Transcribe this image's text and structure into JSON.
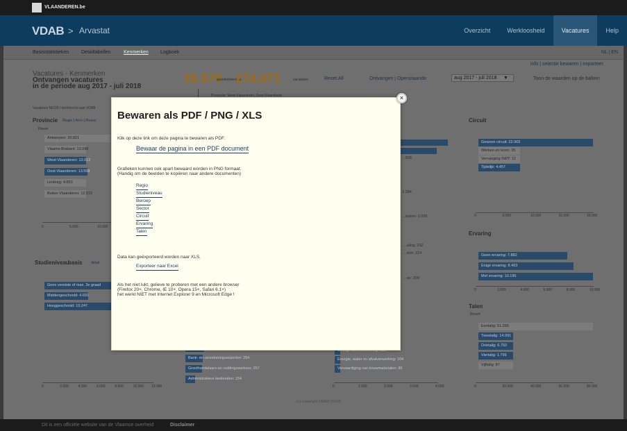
{
  "topbar": {
    "site": "VLAANDEREN.be"
  },
  "header": {
    "logo": "VDAB",
    "breadcrumb_sep": ">",
    "breadcrumb": "Arvastat",
    "nav": [
      "Overzicht",
      "Werkloosheid",
      "Vacatures",
      "Help"
    ],
    "active_nav": "Vacatures"
  },
  "subnav": {
    "items": [
      "Basisstatistieken",
      "Detailtabellen",
      "Kenmerken",
      "Logboek"
    ],
    "active": "Kenmerken",
    "lang": "NL | EN"
  },
  "background": {
    "top_links": "info | selectie bewaren | exporteer",
    "title_line1": "Vacatures - Kenmerken",
    "title_line2": "Ontvangen vacatures",
    "title_line3": "in de periode aug 2017 - juli 2018",
    "count_selected": "26.570",
    "selected_label": "geselecteerd uit",
    "count_total": "274.471",
    "total_label": "vacatures",
    "reset_all": "Reset All",
    "status_toggle": "Ontvangen | Openstaande",
    "period_select": "aug 2017 - juli 2018",
    "show_values": "Toon de waarden op de balken",
    "province_filter": "Provincie: West-Vlaanderen, Oost-Vlaanderen",
    "vacatures_note": "Vacatures NEOS / technische aan VDAB",
    "province_title": "Provincie",
    "province_links": "Regio | Arro | Resoc",
    "province_reset": "Reset",
    "province_bars": [
      {
        "label": "Antwerpen: 20.821",
        "highlight": false,
        "value": 20821
      },
      {
        "label": "Vlaams-Brabant: 13.096",
        "highlight": false,
        "value": 13096
      },
      {
        "label": "West-Vlaanderen: 13.012",
        "highlight": true,
        "value": 13012
      },
      {
        "label": "Oost-Vlaanderen: 13.558",
        "highlight": true,
        "value": 13558
      },
      {
        "label": "Limburg: 4.853",
        "highlight": false,
        "value": 4853
      },
      {
        "label": "Buiten Vlaanderen: 12.572",
        "highlight": false,
        "value": 12572
      }
    ],
    "province_ticks": [
      "0",
      "5.000",
      "10.000"
    ],
    "study_title": "Studieniveau",
    "study_sub": "basis",
    "study_detail": "detail",
    "study_bars": [
      {
        "label": "Geen vereiste of max. 2e graad",
        "value": 10500
      },
      {
        "label": "Middengeschoold: 4.691",
        "value": 4691
      },
      {
        "label": "Hooggeschoold: 10.247",
        "value": 10247
      }
    ],
    "study_ticks": [
      "0",
      "2.000",
      "4.000",
      "6.000",
      "8.000",
      "10.000",
      "12.000"
    ],
    "center_bars": [
      {
        "label": "Ambachtslieden en experten studiedienst: 286",
        "value": 286
      },
      {
        "label": "Bank- en verzekeringsexperten: 264",
        "value": 264
      },
      {
        "label": "Groothandelaars en reddingswerkers: 257",
        "value": 257
      },
      {
        "label": "Administratieve bedienden: 154",
        "value": 154
      }
    ],
    "center_axis_ticks": [
      "0"
    ],
    "sector_labels": [
      {
        "label": "...508"
      },
      {
        "label": "1.284"
      },
      {
        "label": "...staten: 1.035"
      },
      {
        "label": "...aling: 232"
      },
      {
        "label": "...rton: 224"
      },
      {
        "label": "...an: 209"
      }
    ],
    "sector_bars": [
      {
        "label": "Overige dienstverlening: 135",
        "value": 135
      },
      {
        "label": "Energie, water en afvalverwerking: 104",
        "value": 104
      },
      {
        "label": "Vervaardiging van bouwmaterialen: 85",
        "value": 85
      }
    ],
    "sector_ticks": [
      "0",
      "1.000",
      "2.000",
      "3.000",
      "4.000"
    ],
    "circuit_title": "Circuit",
    "circuit_bars": [
      {
        "label": "Gewoon circuit: 22.065",
        "highlight": true,
        "value": 22065
      },
      {
        "label": "Werken en leren: 35",
        "highlight": false,
        "value": 35
      },
      {
        "label": "Vervanging SWT: 12",
        "highlight": false,
        "value": 12
      },
      {
        "label": "Tijdelijk: 4.457",
        "highlight": true,
        "value": 4457
      }
    ],
    "circuit_ticks": [
      "0",
      "5.000",
      "10.000",
      "15.000",
      "20.000"
    ],
    "ervaring_title": "Ervaring",
    "ervaring_bars": [
      {
        "label": "Geen ervaring: 7.882",
        "value": 7882
      },
      {
        "label": "Enige ervaring: 8.493",
        "value": 8493
      },
      {
        "label": "Met ervaring: 10.195",
        "value": 10195
      }
    ],
    "ervaring_ticks": [
      "0",
      "2.000",
      "4.000",
      "6.000",
      "8.000",
      "10.000"
    ],
    "talen_title": "Talen",
    "talen_reset": "Reset",
    "talen_bars": [
      {
        "label": "Eentalig: 51.265",
        "highlight": false,
        "value": 51265
      },
      {
        "label": "Tweetalig: 14.091",
        "highlight": true,
        "value": 14091
      },
      {
        "label": "Drietalig: 6.793",
        "highlight": true,
        "value": 6793
      },
      {
        "label": "Viertalig: 1.799",
        "highlight": true,
        "value": 1799
      },
      {
        "label": "Vijftalig: 87",
        "highlight": false,
        "value": 87
      }
    ],
    "talen_ticks": [
      "0",
      "20.000",
      "40.000",
      "60.000",
      "80.000"
    ],
    "copyright": "(c) copyright VDAB (2018)"
  },
  "modal": {
    "title": "Bewaren als PDF / PNG / XLS",
    "pdf_intro": "Klik op deze link om deze pagina te bewaren als PDF.",
    "pdf_link": "Bewaar de pagina in een PDF document",
    "png_intro1": "Grafieken kunnen ook apart bewaard worden in PNG formaat.",
    "png_intro2": "(Handig om de beelden te kopiëren naar andere documenten)",
    "png_links": [
      "Regio",
      "Studieniveau",
      "Beroep",
      "Sector",
      "Circuit",
      "Ervaring",
      "Talen"
    ],
    "xls_intro": "Data kan geëxporteerd worden naar XLS.",
    "xls_link": "Exporteer naar Excel",
    "browser_note1": "Als het niet lukt, gelieve te proberen met een andere browser",
    "browser_note2": "(Firefox 20+, Chrome, IE 10+, Opera 15+, Safari 6.1+)",
    "browser_note3": "het werkt NIET met Internet Explorer 9 en Microsoft Edge !",
    "close_icon": "×"
  },
  "footer": {
    "text": "Dit is een officiële website van de Vlaamse overheid",
    "link": "Disclaimer"
  }
}
